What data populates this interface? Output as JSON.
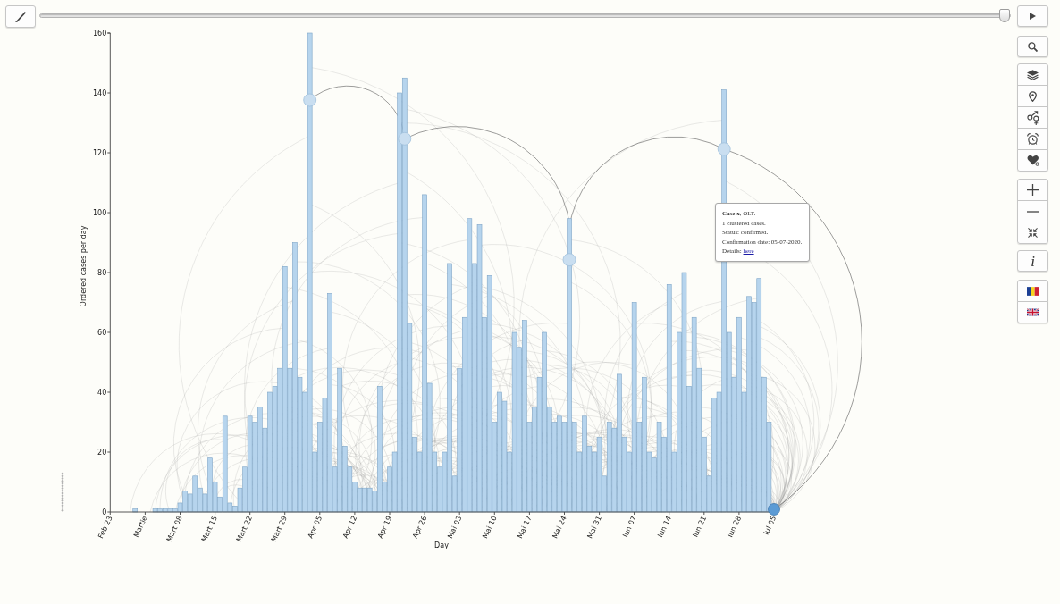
{
  "timeline": {
    "level": 1
  },
  "chart": {
    "chart_data": {
      "type": "bar",
      "xlabel": "Day",
      "ylabel": "Ordered cases per day",
      "categories": [
        "Feb 23",
        null,
        null,
        null,
        null,
        null,
        null,
        "Martie",
        null,
        null,
        null,
        null,
        null,
        null,
        "Mart 08",
        null,
        null,
        null,
        null,
        null,
        null,
        "Mart 15",
        null,
        null,
        null,
        null,
        null,
        null,
        "Mart 22",
        null,
        null,
        null,
        null,
        null,
        null,
        "Mart 29",
        null,
        null,
        null,
        null,
        null,
        null,
        "Apr 05",
        null,
        null,
        null,
        null,
        null,
        null,
        "Apr 12",
        null,
        null,
        null,
        null,
        null,
        null,
        "Apr 19",
        null,
        null,
        null,
        null,
        null,
        null,
        "Apr 26",
        null,
        null,
        null,
        null,
        null,
        null,
        "Mai 03",
        null,
        null,
        null,
        null,
        null,
        null,
        "Mai 10",
        null,
        null,
        null,
        null,
        null,
        null,
        "Mai 17",
        null,
        null,
        null,
        null,
        null,
        null,
        "Mai 24",
        null,
        null,
        null,
        null,
        null,
        null,
        "Mai 31",
        null,
        null,
        null,
        null,
        null,
        null,
        "Iun 07",
        null,
        null,
        null,
        null,
        null,
        null,
        "Iun 14",
        null,
        null,
        null,
        null,
        null,
        null,
        "Iun 21",
        null,
        null,
        null,
        null,
        null,
        null,
        "Iun 28",
        null,
        null,
        null,
        null,
        null,
        null,
        "Iul 05"
      ],
      "values": [
        0,
        0,
        0,
        0,
        0,
        1,
        0,
        0,
        0,
        1,
        1,
        1,
        1,
        1,
        3,
        7,
        6,
        12,
        8,
        6,
        18,
        10,
        5,
        32,
        3,
        2,
        8,
        15,
        32,
        30,
        35,
        28,
        40,
        42,
        48,
        82,
        48,
        90,
        45,
        40,
        160,
        20,
        30,
        38,
        73,
        15,
        48,
        22,
        15,
        10,
        8,
        8,
        8,
        7,
        42,
        10,
        15,
        20,
        140,
        145,
        63,
        25,
        20,
        106,
        43,
        20,
        15,
        20,
        83,
        12,
        48,
        65,
        98,
        83,
        96,
        65,
        79,
        30,
        40,
        37,
        20,
        60,
        55,
        64,
        30,
        35,
        45,
        60,
        35,
        30,
        32,
        30,
        98,
        30,
        20,
        32,
        22,
        20,
        25,
        12,
        30,
        28,
        46,
        25,
        20,
        70,
        30,
        45,
        20,
        18,
        30,
        25,
        76,
        20,
        60,
        80,
        42,
        65,
        48,
        25,
        12,
        38,
        40,
        141,
        60,
        45,
        65,
        40,
        72,
        70,
        78,
        45,
        30,
        0
      ],
      "ylim": [
        0,
        160
      ],
      "yticks": [
        0,
        20,
        40,
        60,
        80,
        100,
        120,
        140,
        160
      ]
    }
  },
  "tooltip": {
    "lines": [
      "**Case x**, OLT.",
      "1 clustered cases.",
      "Status: confirmed.",
      "Confirmation date: 05-07-2020."
    ],
    "details": {
      "label": "Details:",
      "link": "here"
    }
  },
  "side_toolbar": {
    "info_label": "i"
  }
}
